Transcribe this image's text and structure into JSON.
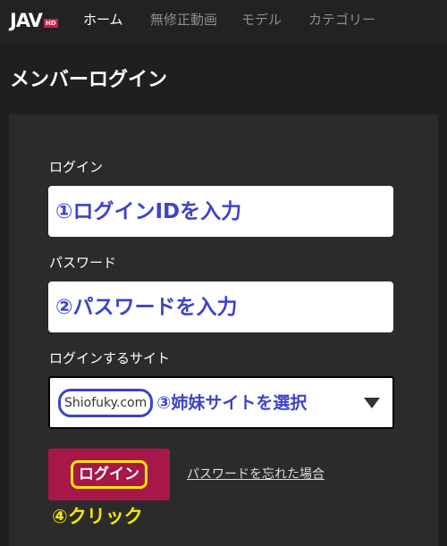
{
  "header": {
    "logo_text": "JAV",
    "logo_badge": "HD",
    "nav": [
      {
        "label": "ホーム",
        "active": true
      },
      {
        "label": "無修正動画",
        "active": false
      },
      {
        "label": "モデル",
        "active": false
      },
      {
        "label": "カテゴリー",
        "active": false
      }
    ]
  },
  "page": {
    "title": "メンバーログイン"
  },
  "form": {
    "login_label": "ログイン",
    "login_annotation": "①ログインIDを入力",
    "password_label": "パスワード",
    "password_annotation": "②パスワードを入力",
    "site_label": "ログインするサイト",
    "site_selected": "Shiofuky.com",
    "site_annotation": "③姉妹サイトを選択",
    "login_button": "ログイン",
    "forgot_link": "パスワードを忘れた場合",
    "click_annotation": "④クリック"
  },
  "colors": {
    "background": "#1f1f1f",
    "panel": "#2b2b2b",
    "accent": "#a8174a",
    "annotation_blue": "#3c44c9",
    "annotation_yellow": "#f5e600"
  }
}
